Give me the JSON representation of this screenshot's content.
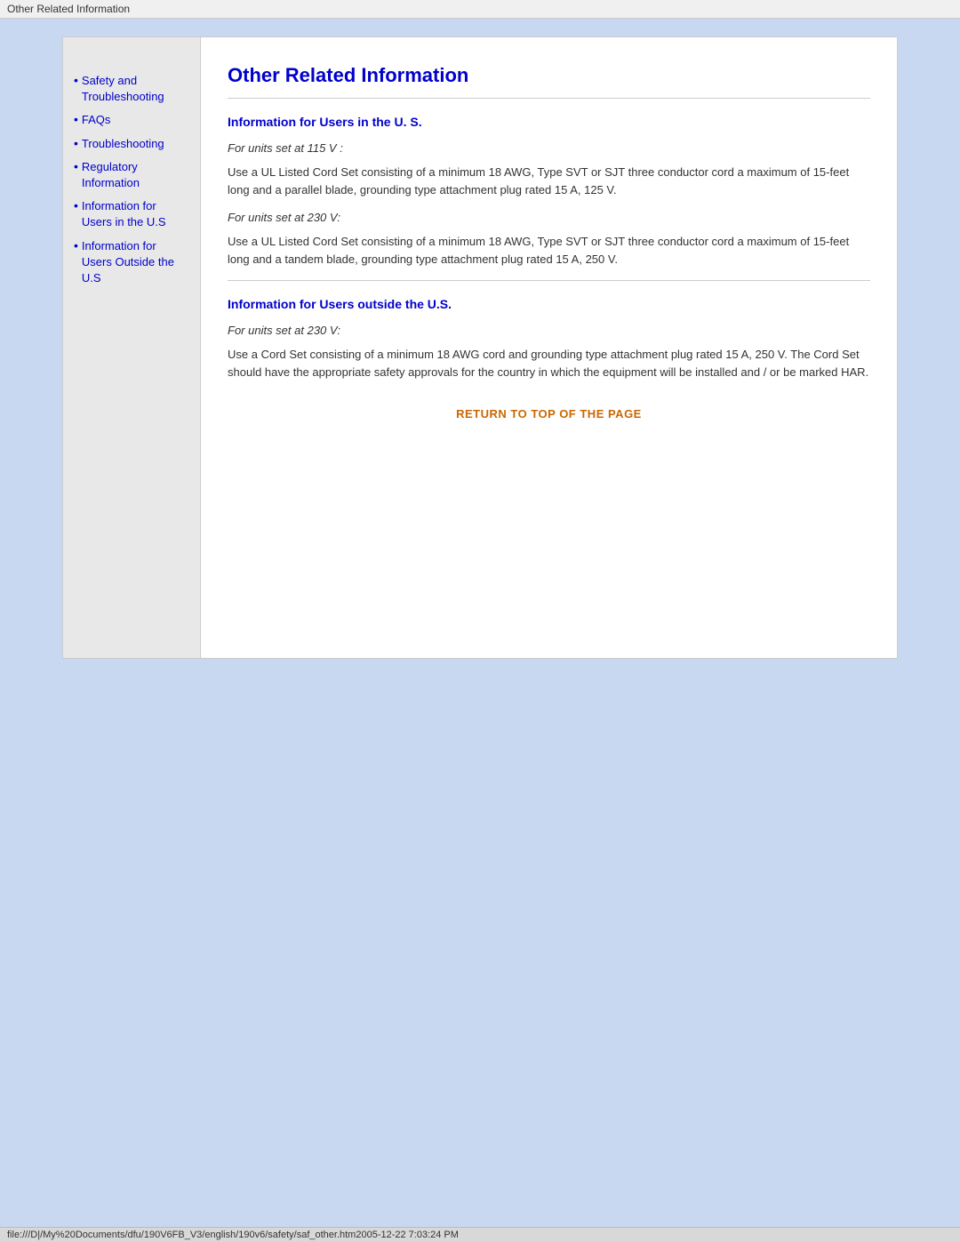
{
  "title_bar": {
    "text": "Other Related Information"
  },
  "sidebar": {
    "items": [
      {
        "label": "Safety and Troubleshooting",
        "href": "#"
      },
      {
        "label": "FAQs",
        "href": "#"
      },
      {
        "label": "Troubleshooting",
        "href": "#"
      },
      {
        "label": "Regulatory Information",
        "href": "#"
      },
      {
        "label": "Information for Users in the U.S",
        "href": "#"
      },
      {
        "label": "Information for Users Outside the U.S",
        "href": "#"
      }
    ]
  },
  "main": {
    "page_title": "Other Related Information",
    "section1": {
      "title": "Information for Users in the U. S.",
      "subsection1": {
        "intro": "For units set at 115 V :",
        "body": "Use a UL Listed Cord Set consisting of a minimum 18 AWG, Type SVT or SJT three conductor cord a maximum of 15-feet long and a parallel blade, grounding type attachment plug rated 15 A, 125 V."
      },
      "subsection2": {
        "intro": "For units set at 230 V:",
        "body": "Use a UL Listed Cord Set consisting of a minimum 18 AWG, Type SVT or SJT three conductor cord a maximum of 15-feet long and a tandem blade, grounding type attachment plug rated 15 A, 250 V."
      }
    },
    "section2": {
      "title": "Information for Users outside the U.S.",
      "subsection1": {
        "intro": "For units set at 230 V:",
        "body": "Use a Cord Set consisting of a minimum 18 AWG cord and grounding type attachment plug rated 15 A, 250 V. The Cord Set should have the appropriate safety approvals for the country in which the equipment will be installed and / or be marked HAR."
      }
    },
    "return_link": "RETURN TO TOP OF THE PAGE"
  },
  "status_bar": {
    "text": "file:///D|/My%20Documents/dfu/190V6FB_V3/english/190v6/safety/saf_other.htm2005-12-22  7:03:24 PM"
  }
}
